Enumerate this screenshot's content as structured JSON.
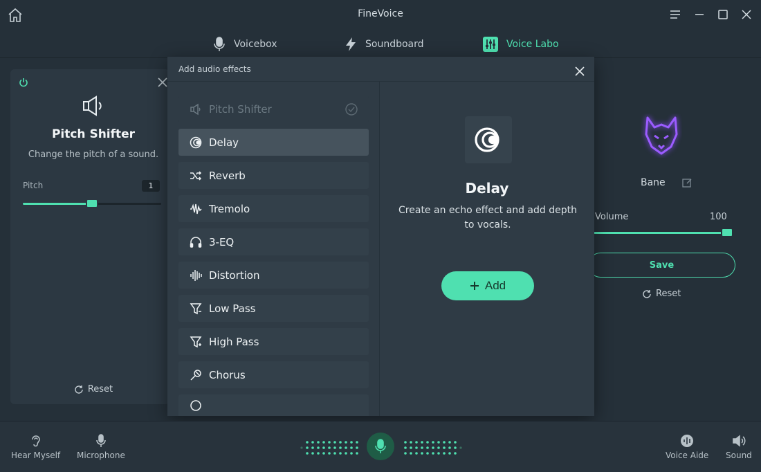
{
  "app": {
    "title": "FineVoice"
  },
  "tabs": [
    {
      "label": "Voicebox",
      "icon": "mic-icon",
      "active": false
    },
    {
      "label": "Soundboard",
      "icon": "lightning-icon",
      "active": false
    },
    {
      "label": "Voice Labo",
      "icon": "sliders-icon",
      "active": true
    }
  ],
  "left_panel": {
    "title": "Pitch Shifter",
    "description": "Change the pitch of a sound.",
    "pitch_label": "Pitch",
    "pitch_value": "1",
    "reset_label": "Reset"
  },
  "right_panel": {
    "voice_name": "Bane",
    "volume_label": "Volume",
    "volume_value": "100",
    "save_label": "Save",
    "reset_label": "Reset"
  },
  "modal": {
    "title": "Add audio effects",
    "effects": [
      {
        "label": "Pitch Shifter",
        "icon": "speaker-icon",
        "state": "disabled"
      },
      {
        "label": "Delay",
        "icon": "delay-icon",
        "state": "selected"
      },
      {
        "label": "Reverb",
        "icon": "shuffle-icon",
        "state": "normal"
      },
      {
        "label": "Tremolo",
        "icon": "waveform-icon",
        "state": "normal"
      },
      {
        "label": "3-EQ",
        "icon": "headphones-icon",
        "state": "normal"
      },
      {
        "label": "Distortion",
        "icon": "bars-icon",
        "state": "normal"
      },
      {
        "label": "Low Pass",
        "icon": "filter-icon",
        "state": "normal"
      },
      {
        "label": "High Pass",
        "icon": "filter-icon",
        "state": "normal"
      },
      {
        "label": "Chorus",
        "icon": "microphone-stand-icon",
        "state": "normal"
      }
    ],
    "detail": {
      "title": "Delay",
      "description": "Create an echo effect and add depth to vocals.",
      "add_label": "Add"
    }
  },
  "bottom_bar": {
    "hear_myself": "Hear Myself",
    "microphone": "Microphone",
    "voice_aide": "Voice Aide",
    "sound": "Sound"
  },
  "colors": {
    "accent": "#4fe0b0",
    "background": "#253039",
    "panel": "#2c3842",
    "modal": "#2f3b45"
  }
}
